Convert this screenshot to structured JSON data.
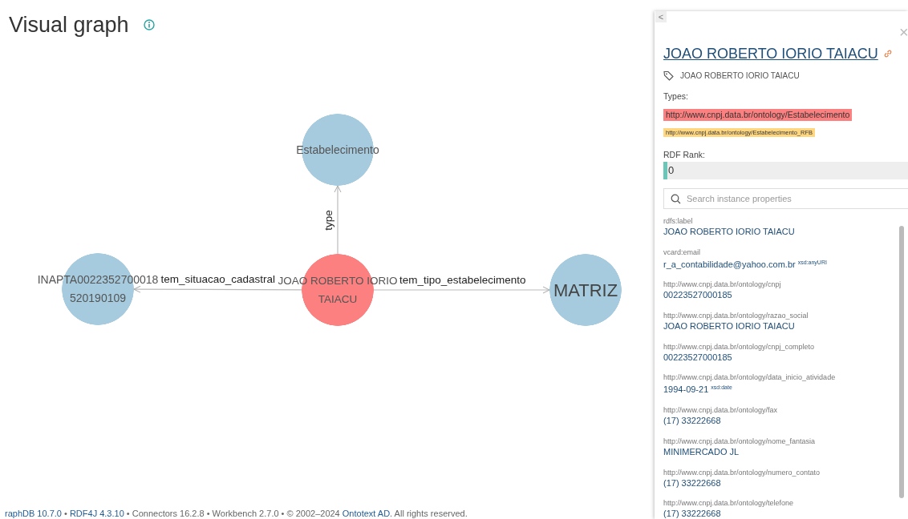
{
  "header": {
    "title": "Visual graph"
  },
  "graph": {
    "nodes": [
      {
        "label": "Estabelecimento",
        "kind": "type",
        "color": "#a6cbdf"
      },
      {
        "label": "INAPTA0022352700018520190109",
        "kind": "literal",
        "color": "#a6cbdf"
      },
      {
        "label": "JOAO ROBERTO IORIO TAIACU",
        "kind": "focus",
        "color": "#fd8080"
      },
      {
        "label": "MATRIZ",
        "kind": "literal-large",
        "color": "#a6cbdf"
      }
    ],
    "edges": [
      {
        "label": "type",
        "kind": "up"
      },
      {
        "label": "tem_situacao_cadastral",
        "kind": "left"
      },
      {
        "label": "tem_tipo_estabelecimento",
        "kind": "right"
      }
    ]
  },
  "footer": [
    {
      "text": "raphDB 10.7.0",
      "kind": "link"
    },
    {
      "text": " • ",
      "kind": "text"
    },
    {
      "text": "RDF4J 4.3.10",
      "kind": "link"
    },
    {
      "text": " • Connectors 16.2.8 • Workbench 2.7.0 • © 2002–2024 ",
      "kind": "text"
    },
    {
      "text": "Ontotext AD",
      "kind": "link"
    },
    {
      "text": ". All rights reserved.",
      "kind": "text"
    }
  ],
  "panel": {
    "collapse": "<",
    "close": "×",
    "title": "JOAO ROBERTO IORIO TAIACU",
    "label": "JOAO ROBERTO IORIO TAIACU",
    "types_heading": "Types:",
    "types": [
      {
        "text": "http://www.cnpj.data.br/ontology/Estabelecimento",
        "color": "#fd8080",
        "kind": "primary"
      },
      {
        "text": "http://www.cnpj.data.br/ontology/Estabelecimento_RFB",
        "color": "#ffd780",
        "kind": "secondary"
      }
    ],
    "rank_heading": "RDF Rank:",
    "rank": {
      "level": 0,
      "reading": "0"
    },
    "search": {
      "placeholder": "Search instance properties"
    },
    "properties": [
      {
        "name": "rdfs:label",
        "value": "JOAO ROBERTO IORIO TAIACU"
      },
      {
        "name": "vcard:email",
        "value": "r_a_contabilidade@yahoo.com.br",
        "datatype": "xsd:anyURI"
      },
      {
        "name": "http://www.cnpj.data.br/ontology/cnpj",
        "value": "00223527000185"
      },
      {
        "name": "http://www.cnpj.data.br/ontology/razao_social",
        "value": "JOAO ROBERTO IORIO TAIACU"
      },
      {
        "name": "http://www.cnpj.data.br/ontology/cnpj_completo",
        "value": "00223527000185"
      },
      {
        "name": "http://www.cnpj.data.br/ontology/data_inicio_atividade",
        "value": "1994-09-21",
        "datatype": "xsd:date"
      },
      {
        "name": "http://www.cnpj.data.br/ontology/fax",
        "value": "(17) 33222668"
      },
      {
        "name": "http://www.cnpj.data.br/ontology/nome_fantasia",
        "value": "MINIMERCADO JL"
      },
      {
        "name": "http://www.cnpj.data.br/ontology/numero_contato",
        "value": "(17) 33222668"
      },
      {
        "name": "http://www.cnpj.data.br/ontology/telefone",
        "value": "(17) 33222668"
      }
    ]
  }
}
